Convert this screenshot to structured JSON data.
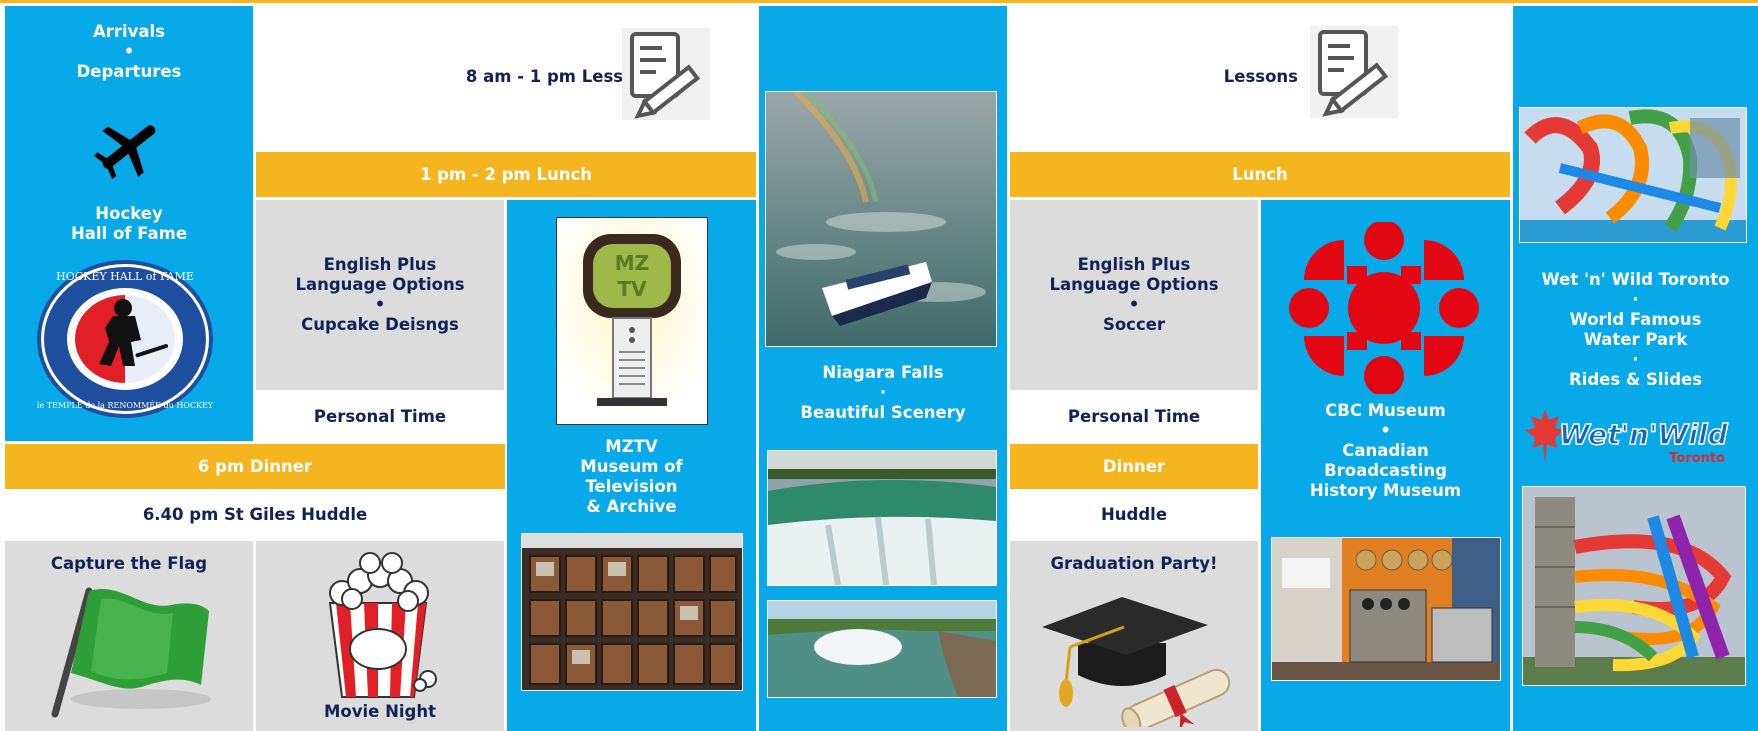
{
  "col1": {
    "arrivals": "Arrivals",
    "bullet": "•",
    "departures": "Departures",
    "hockey_title": "Hockey\nHall of Fame",
    "seal_text_top": "HOCKEY HALL of FAME",
    "seal_text_bottom": "le TEMPLE de la RENOMMÉE du HOCKEY"
  },
  "day1": {
    "lessons": "8 am - 1 pm Lessons",
    "lunch": "1 pm - 2 pm  Lunch",
    "activity": "English Plus\nLanguage Options\n•\nCupcake Deisngs",
    "personal_time": "Personal Time",
    "dinner": "6 pm Dinner",
    "huddle": "6.40 pm St Giles Huddle",
    "capture_flag": "Capture the Flag",
    "movie_night": "Movie Night",
    "mztv_sign": "MZ\nTV",
    "mztv": "MZTV\nMuseum of\nTelevision\n& Archive"
  },
  "niagara": {
    "text": "Niagara Falls\n·\nBeautiful Scenery"
  },
  "day2": {
    "lessons": "Lessons",
    "lunch": "Lunch",
    "activity": "English Plus\nLanguage Options\n•\nSoccer",
    "personal_time": "Personal Time",
    "dinner": "Dinner",
    "huddle": "Huddle",
    "graduation": "Graduation Party!",
    "cbc": "CBC Museum\n•\nCanadian\nBroadcasting\nHistory Museum"
  },
  "wetnwild": {
    "text": "Wet 'n' Wild Toronto\n·\nWorld Famous\nWater Park\n·\nRides & Slides",
    "logo_word": "Wet'n'Wild",
    "logo_city": "Toronto"
  },
  "colors": {
    "blue": "#07A9E8",
    "gold": "#F5B51E",
    "grey": "#DCDCDC",
    "navy": "#0F2357"
  }
}
